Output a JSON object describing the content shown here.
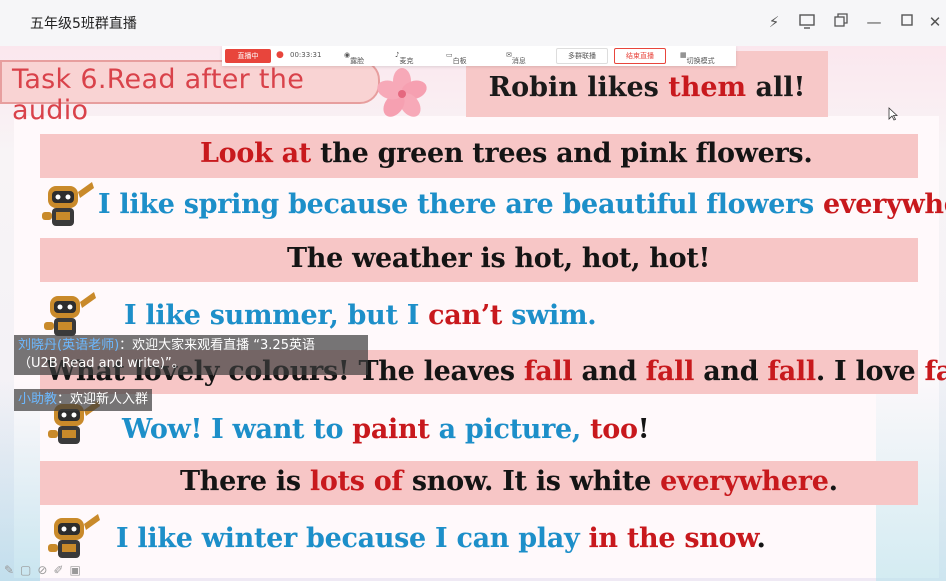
{
  "window": {
    "title": "五年级5班群直播",
    "icons": [
      "lightning-icon",
      "screen-share-icon",
      "restore-window-icon",
      "minimize-icon",
      "maximize-icon",
      "close-icon"
    ]
  },
  "live_toolbar": {
    "badge": "直播中",
    "timer": "00:33:31",
    "items": [
      "露脸",
      "麦克",
      "白板",
      "消息"
    ],
    "multi_group": "多群联播",
    "end_live": "结束直播",
    "switch_mode": "切换模式"
  },
  "slide": {
    "task_title": "Task 6.Read after the audio",
    "heading": {
      "pre": "Robin likes ",
      "highlight": "them",
      "post": " all!"
    },
    "lines": {
      "l1": {
        "a": "Look at",
        "b": " the green trees and pink flowers."
      },
      "l2": {
        "a": "I like spring because there are beautiful flowers ",
        "b": "everywhere",
        "c": "."
      },
      "l3": {
        "a": "The weather is hot, hot, hot!"
      },
      "l4": {
        "a": "I like summer, but I ",
        "b": "can’t",
        "c": " swim."
      },
      "l5": {
        "a": "What lovely colours! The leaves ",
        "b": "fall",
        "c": " and ",
        "d": "fall",
        "e": " and ",
        "f": "fall",
        "g": ". I love ",
        "h": "fall",
        "i": "!"
      },
      "l6": {
        "a": "Wow! I want to ",
        "b": "paint",
        "c": " a picture, ",
        "d": "too",
        "e": "!"
      },
      "l7": {
        "a": "There is ",
        "b": "lots of",
        "c": " snow. It is white ",
        "d": "everywhere",
        "e": "."
      },
      "l8": {
        "a": "I like winter because I can play ",
        "b": "in the snow",
        "c": "."
      }
    }
  },
  "chat": {
    "msg1_name": "刘晓丹(英语老师)",
    "msg1_text": "：欢迎大家来观看直播 “3.25英语",
    "msg1_cont": "（U2B Read and write)”。",
    "msg2_name": "小助教",
    "msg2_text": "：欢迎新人入群"
  },
  "colors": {
    "accent_red": "#c8191d",
    "text_blue": "#1d8fc9",
    "band_pink": "#f7c6c6",
    "live_red": "#e8453c"
  }
}
